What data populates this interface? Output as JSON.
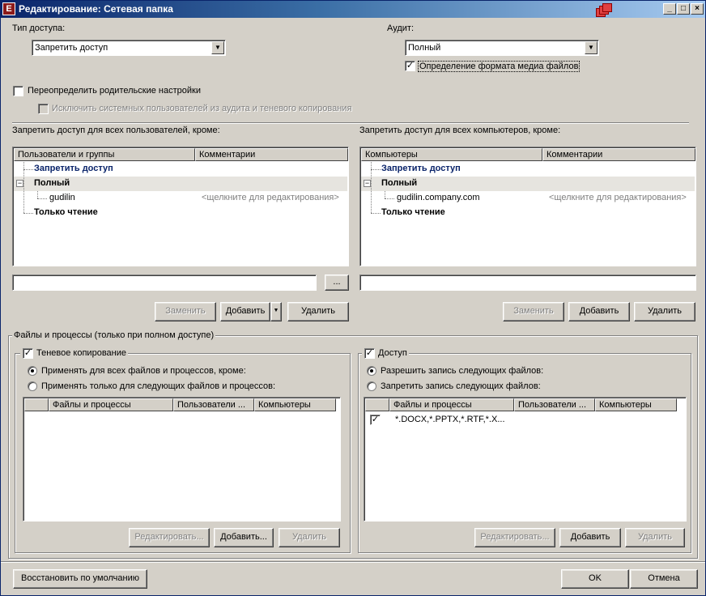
{
  "window": {
    "title": "Редактирование: Сетевая папка",
    "app_icon_letter": "E",
    "controls": {
      "minimize": "_",
      "maximize": "□",
      "close": "×"
    }
  },
  "access_type": {
    "label": "Тип доступа:",
    "value": "Запретить доступ"
  },
  "audit": {
    "label": "Аудит:",
    "value": "Полный",
    "media_detect_label": "Определение формата медиа файлов",
    "media_detect_checked": true
  },
  "override": {
    "label": "Переопределить родительские настройки",
    "checked": false
  },
  "exclude_system": {
    "label": "Исключить системных пользователей из аудита и теневого копирования",
    "checked": false,
    "enabled": false
  },
  "users_panel": {
    "heading": "Запретить доступ для всех пользователей, кроме:",
    "columns": [
      "Пользователи и группы",
      "Комментарии"
    ],
    "rows": [
      {
        "label": "Запретить доступ",
        "comment": ""
      },
      {
        "label": "Полный",
        "comment": ""
      },
      {
        "label": "gudilin",
        "comment": "<щелкните для редактирования>"
      },
      {
        "label": "Только чтение",
        "comment": ""
      }
    ],
    "browse_label": "...",
    "buttons": {
      "replace": "Заменить",
      "add": "Добавить",
      "add_arrow": "▼",
      "delete": "Удалить"
    }
  },
  "computers_panel": {
    "heading": "Запретить доступ для всех компьютеров, кроме:",
    "columns": [
      "Компьютеры",
      "Комментарии"
    ],
    "rows": [
      {
        "label": "Запретить доступ",
        "comment": ""
      },
      {
        "label": "Полный",
        "comment": ""
      },
      {
        "label": "gudilin.company.com",
        "comment": "<щелкните для редактирования>"
      },
      {
        "label": "Только чтение",
        "comment": ""
      }
    ],
    "buttons": {
      "replace": "Заменить",
      "add": "Добавить",
      "delete": "Удалить"
    }
  },
  "files_group": {
    "title": "Файлы и процессы (только при полном доступе)",
    "shadow": {
      "title": "Теневое копирование",
      "checked": true,
      "radio_all": "Применять для всех файлов и процессов, кроме:",
      "radio_only": "Применять только для следующих файлов и процессов:",
      "selected": "all",
      "columns": [
        "Файлы и процессы",
        "Пользователи ...",
        "Компьютеры"
      ],
      "buttons": {
        "edit": "Редактировать...",
        "add": "Добавить...",
        "delete": "Удалить"
      }
    },
    "access": {
      "title": "Доступ",
      "checked": true,
      "radio_allow": "Разрешить запись следующих файлов:",
      "radio_deny": "Запретить запись следующих файлов:",
      "selected": "allow",
      "columns": [
        "Файлы и процессы",
        "Пользователи ...",
        "Компьютеры"
      ],
      "rows": [
        {
          "checked": true,
          "files": "*.DOCX,*.PPTX,*.RTF,*.X..."
        }
      ],
      "buttons": {
        "edit": "Редактировать...",
        "add": "Добавить",
        "delete": "Удалить"
      }
    }
  },
  "footer": {
    "restore": "Восстановить по умолчанию",
    "ok": "OK",
    "cancel": "Отмена"
  },
  "colors": {
    "face": "#d4d0c8",
    "title_start": "#0a246a",
    "title_end": "#a6caf0",
    "group_label": "#0a246a"
  }
}
